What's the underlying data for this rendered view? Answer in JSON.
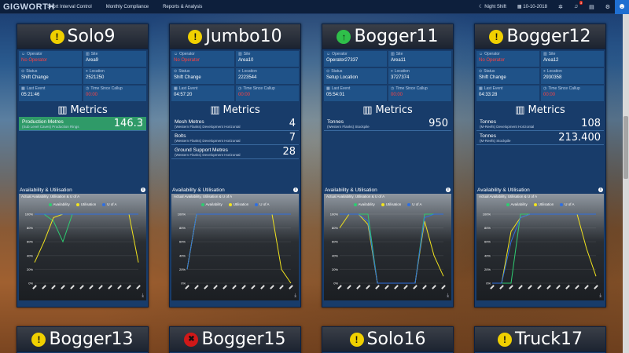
{
  "nav": {
    "logo": "GIGWORTH",
    "items": [
      "Short Interval Control",
      "Monthly Compliance",
      "Reports & Analysis"
    ],
    "shift": "Night Shift",
    "date": "10-10-2018",
    "alerts_count": "3"
  },
  "labels": {
    "operator": "Operator",
    "site": "Site",
    "status": "Status",
    "location": "Location",
    "last_event": "Last Event",
    "time_since": "Time Since Callup",
    "metrics": "Metrics",
    "avail": "Availability & Utilisation",
    "chart_sub": "Actual Availability, Utilisation & U of A",
    "legend": [
      "Availability",
      "Utilisation",
      "U of A"
    ]
  },
  "colors": {
    "availability": "#2ecc71",
    "utilisation": "#f1e31e",
    "uofa": "#2f6fe0"
  },
  "cards": [
    {
      "name": "Solo9",
      "status_icon": "warning",
      "operator": "No Operator",
      "site": "Area9",
      "status": "Shift Change",
      "location": "2521250",
      "last_event": "05:21:46",
      "time_since": "00:00",
      "metrics": [
        {
          "name": "Production Metres",
          "sub": "(Sub Level Caves) Production Rings",
          "value": "146.3",
          "highlight": true
        }
      ]
    },
    {
      "name": "Jumbo10",
      "status_icon": "warning",
      "operator": "No Operator",
      "site": "Area10",
      "status": "Shift Change",
      "location": "2223544",
      "last_event": "04:57:20",
      "time_since": "00:00",
      "metrics": [
        {
          "name": "Mesh Metres",
          "sub": "(Western Flanks) Development Horizontal",
          "value": "4"
        },
        {
          "name": "Bolts",
          "sub": "(Western Flanks) Development Horizontal",
          "value": "7"
        },
        {
          "name": "Ground Support Metres",
          "sub": "(Western Flanks) Development Horizontal",
          "value": "28"
        }
      ]
    },
    {
      "name": "Bogger11",
      "status_icon": "ok",
      "operator": "Operator27337",
      "site": "Area11",
      "status": "Setup Location",
      "location": "3727374",
      "last_event": "05:54:01",
      "time_since": "00:00",
      "metrics": [
        {
          "name": "Tonnes",
          "sub": "(Western Flanks) Stockpile",
          "value": "950"
        }
      ]
    },
    {
      "name": "Bogger12",
      "status_icon": "warning",
      "operator": "No Operator",
      "site": "Area12",
      "status": "Shift Change",
      "location": "2930358",
      "last_event": "04:33:28",
      "time_since": "00:00",
      "metrics": [
        {
          "name": "Tonnes",
          "sub": "(M-Reefs) Development Horizontal",
          "value": "108"
        },
        {
          "name": "Tonnes",
          "sub": "(M-Reefs) Stockpile",
          "value": "213.400"
        }
      ]
    }
  ],
  "bottom_cards": [
    {
      "name": "Bogger13",
      "status_icon": "warning"
    },
    {
      "name": "Bogger15",
      "status_icon": "error"
    },
    {
      "name": "Solo16",
      "status_icon": "warning"
    },
    {
      "name": "Truck17",
      "status_icon": "warning"
    }
  ],
  "chart_data": [
    {
      "type": "line",
      "title": "Actual Availability, Utilisation & U of A",
      "yticks": [
        "0%",
        "20%",
        "40%",
        "60%",
        "80%",
        "100%"
      ],
      "ylim": [
        0,
        100
      ],
      "series": [
        {
          "name": "Availability",
          "values": [
            100,
            100,
            90,
            60,
            100,
            100,
            100,
            100,
            100,
            100,
            100,
            100
          ]
        },
        {
          "name": "Utilisation",
          "values": [
            30,
            60,
            95,
            100,
            100,
            100,
            100,
            100,
            100,
            100,
            100,
            30
          ]
        },
        {
          "name": "U of A",
          "values": [
            100,
            100,
            100,
            100,
            100,
            100,
            100,
            100,
            100,
            100,
            100,
            100
          ]
        }
      ]
    },
    {
      "type": "line",
      "title": "Actual Availability, Utilisation & U of A",
      "yticks": [
        "0%",
        "20%",
        "40%",
        "60%",
        "80%",
        "100%"
      ],
      "ylim": [
        0,
        100
      ],
      "series": [
        {
          "name": "Availability",
          "values": [
            20,
            100,
            100,
            100,
            100,
            100,
            100,
            100,
            100,
            100,
            100,
            100
          ]
        },
        {
          "name": "Utilisation",
          "values": [
            20,
            100,
            100,
            100,
            100,
            100,
            100,
            100,
            100,
            100,
            20,
            0
          ]
        },
        {
          "name": "U of A",
          "values": [
            20,
            100,
            100,
            100,
            100,
            100,
            100,
            100,
            100,
            100,
            100,
            100
          ]
        }
      ]
    },
    {
      "type": "line",
      "title": "Actual Availability, Utilisation & U of A",
      "yticks": [
        "0%",
        "20%",
        "40%",
        "60%",
        "80%",
        "100%"
      ],
      "ylim": [
        0,
        100
      ],
      "series": [
        {
          "name": "Availability",
          "values": [
            100,
            100,
            100,
            100,
            0,
            0,
            0,
            0,
            0,
            100,
            100,
            100
          ]
        },
        {
          "name": "Utilisation",
          "values": [
            80,
            100,
            100,
            85,
            0,
            0,
            0,
            0,
            0,
            90,
            40,
            10
          ]
        },
        {
          "name": "U of A",
          "values": [
            100,
            100,
            100,
            90,
            0,
            0,
            0,
            0,
            0,
            95,
            100,
            100
          ]
        }
      ]
    },
    {
      "type": "line",
      "title": "Actual Availability, Utilisation & U of A",
      "yticks": [
        "0%",
        "20%",
        "40%",
        "60%",
        "80%",
        "100%"
      ],
      "ylim": [
        0,
        100
      ],
      "series": [
        {
          "name": "Availability",
          "values": [
            0,
            0,
            0,
            100,
            100,
            100,
            100,
            100,
            100,
            100,
            100,
            100
          ]
        },
        {
          "name": "Utilisation",
          "values": [
            0,
            0,
            75,
            95,
            100,
            100,
            100,
            100,
            100,
            100,
            50,
            10
          ]
        },
        {
          "name": "U of A",
          "values": [
            0,
            0,
            60,
            95,
            100,
            100,
            100,
            100,
            100,
            100,
            100,
            100
          ]
        }
      ]
    }
  ]
}
